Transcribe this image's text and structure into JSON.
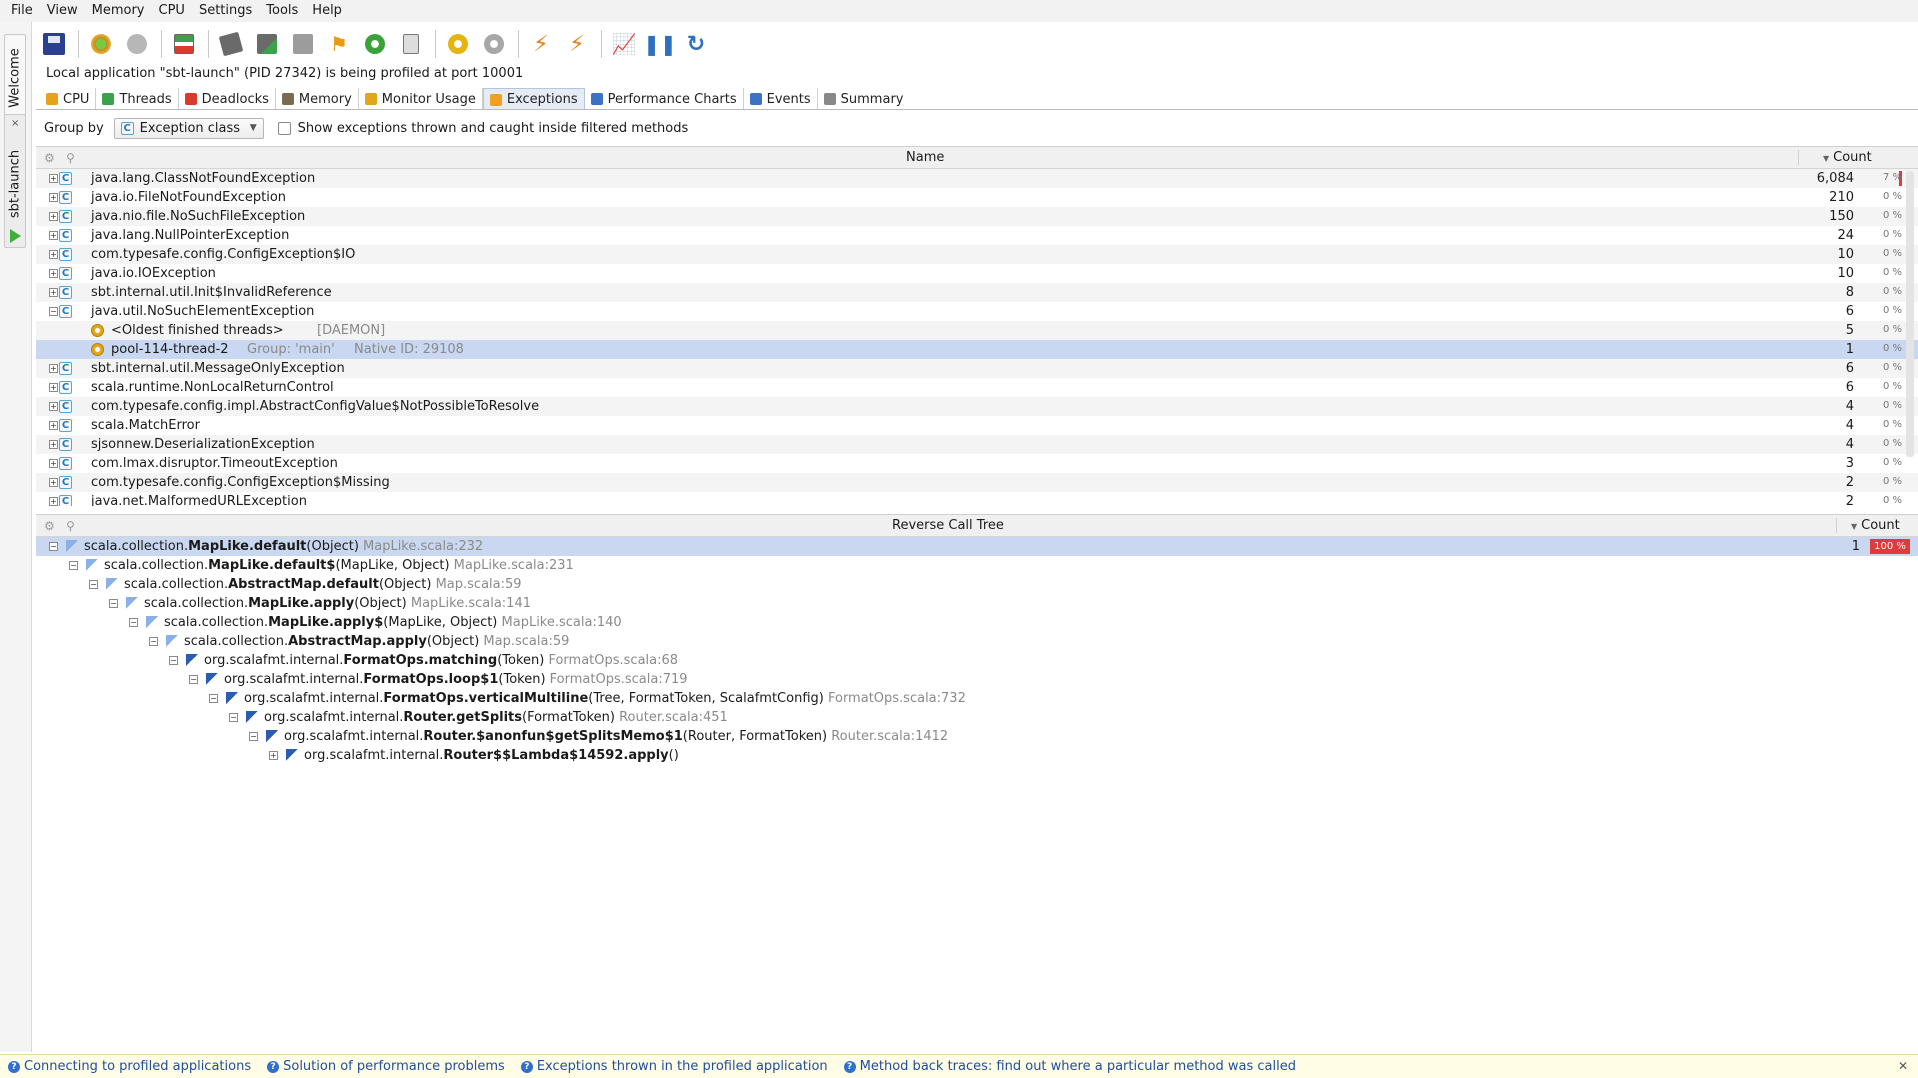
{
  "menu": [
    "File",
    "View",
    "Memory",
    "CPU",
    "Settings",
    "Tools",
    "Help"
  ],
  "side_tabs": {
    "welcome": "Welcome",
    "session": "sbt-launch"
  },
  "status_line": "Local application \"sbt-launch\" (PID 27342) is being profiled at port 10001",
  "view_tabs": [
    {
      "label": "CPU",
      "color": "#e6a21c"
    },
    {
      "label": "Threads",
      "color": "#3aa24a"
    },
    {
      "label": "Deadlocks",
      "color": "#d83b2b"
    },
    {
      "label": "Memory",
      "color": "#7a6a4f"
    },
    {
      "label": "Monitor Usage",
      "color": "#e0a71c"
    },
    {
      "label": "Exceptions",
      "color": "#f0a020"
    },
    {
      "label": "Performance Charts",
      "color": "#3a72c4"
    },
    {
      "label": "Events",
      "color": "#3a72c4"
    },
    {
      "label": "Summary",
      "color": "#888888"
    }
  ],
  "active_view_tab": "Exceptions",
  "group_by": {
    "label": "Group by",
    "value": "Exception class",
    "checkbox_label": "Show exceptions thrown and caught inside filtered methods"
  },
  "exceptions": {
    "header_name": "Name",
    "header_count": "Count",
    "rows": [
      {
        "name": "java.lang.ClassNotFoundException",
        "count": "6,084",
        "pct": "7 %"
      },
      {
        "name": "java.io.FileNotFoundException",
        "count": "210",
        "pct": "0 %"
      },
      {
        "name": "java.nio.file.NoSuchFileException",
        "count": "150",
        "pct": "0 %"
      },
      {
        "name": "java.lang.NullPointerException",
        "count": "24",
        "pct": "0 %"
      },
      {
        "name": "com.typesafe.config.ConfigException$IO",
        "count": "10",
        "pct": "0 %"
      },
      {
        "name": "java.io.IOException",
        "count": "10",
        "pct": "0 %"
      },
      {
        "name": "sbt.internal.util.Init$InvalidReference",
        "count": "8",
        "pct": "0 %"
      },
      {
        "name": "java.util.NoSuchElementException",
        "count": "6",
        "pct": "0 %"
      },
      {
        "name": "sbt.internal.util.MessageOnlyException",
        "count": "6",
        "pct": "0 %"
      },
      {
        "name": "scala.runtime.NonLocalReturnControl",
        "count": "6",
        "pct": "0 %"
      },
      {
        "name": "com.typesafe.config.impl.AbstractConfigValue$NotPossibleToResolve",
        "count": "4",
        "pct": "0 %"
      },
      {
        "name": "scala.MatchError",
        "count": "4",
        "pct": "0 %"
      },
      {
        "name": "sjsonnew.DeserializationException",
        "count": "4",
        "pct": "0 %"
      },
      {
        "name": "com.lmax.disruptor.TimeoutException",
        "count": "3",
        "pct": "0 %"
      },
      {
        "name": "com.typesafe.config.ConfigException$Missing",
        "count": "2",
        "pct": "0 %"
      }
    ],
    "thread_rows": [
      {
        "name": "<Oldest finished threads>",
        "extra": "[DAEMON]",
        "native": "",
        "count": "5",
        "pct": "0 %"
      },
      {
        "name": "pool-114-thread-2",
        "extra": "Group: 'main'",
        "native": "Native ID: 29108",
        "count": "1",
        "pct": "0 %"
      }
    ],
    "cut_row": {
      "name": "java.net.MalformedURLException",
      "count": "2",
      "pct": "0 %"
    },
    "first_pct_fraction": 0.07
  },
  "call_tree": {
    "header_name": "Reverse Call Tree",
    "header_count": "Count",
    "rows": [
      {
        "pre": "scala.collection.",
        "cls": "MapLike.default",
        "args": "(Object)",
        "loc": "MapLike.scala:232",
        "count": "1",
        "pct": "100 %",
        "kind": "light"
      },
      {
        "pre": "scala.collection.",
        "cls": "MapLike.default$",
        "args": "(MapLike, Object)",
        "loc": "MapLike.scala:231",
        "count": "",
        "pct": "",
        "kind": "light"
      },
      {
        "pre": "scala.collection.",
        "cls": "AbstractMap.default",
        "args": "(Object)",
        "loc": "Map.scala:59",
        "count": "",
        "pct": "",
        "kind": "light"
      },
      {
        "pre": "scala.collection.",
        "cls": "MapLike.apply",
        "args": "(Object)",
        "loc": "MapLike.scala:141",
        "count": "",
        "pct": "",
        "kind": "light"
      },
      {
        "pre": "scala.collection.",
        "cls": "MapLike.apply$",
        "args": "(MapLike, Object)",
        "loc": "MapLike.scala:140",
        "count": "",
        "pct": "",
        "kind": "light"
      },
      {
        "pre": "scala.collection.",
        "cls": "AbstractMap.apply",
        "args": "(Object)",
        "loc": "Map.scala:59",
        "count": "",
        "pct": "",
        "kind": "light"
      },
      {
        "pre": "org.scalafmt.internal.",
        "cls": "FormatOps.matching",
        "args": "(Token)",
        "loc": "FormatOps.scala:68",
        "count": "",
        "pct": "",
        "kind": "dark"
      },
      {
        "pre": "org.scalafmt.internal.",
        "cls": "FormatOps.loop$1",
        "args": "(Token)",
        "loc": "FormatOps.scala:719",
        "count": "",
        "pct": "",
        "kind": "dark"
      },
      {
        "pre": "org.scalafmt.internal.",
        "cls": "FormatOps.verticalMultiline",
        "args": "(Tree, FormatToken, ScalafmtConfig)",
        "loc": "FormatOps.scala:732",
        "count": "",
        "pct": "",
        "kind": "dark"
      },
      {
        "pre": "org.scalafmt.internal.",
        "cls": "Router.getSplits",
        "args": "(FormatToken)",
        "loc": "Router.scala:451",
        "count": "",
        "pct": "",
        "kind": "dark"
      },
      {
        "pre": "org.scalafmt.internal.",
        "cls": "Router.$anonfun$getSplitsMemo$1",
        "args": "(Router, FormatToken)",
        "loc": "Router.scala:1412",
        "count": "",
        "pct": "",
        "kind": "dark"
      },
      {
        "pre": "org.scalafmt.internal.",
        "cls": "Router$$Lambda$14592.apply",
        "args": "()",
        "loc": "",
        "count": "",
        "pct": "",
        "kind": "dark"
      }
    ]
  },
  "help_links": [
    "Connecting to profiled applications",
    "Solution of performance problems",
    "Exceptions thrown in the profiled application",
    "Method back traces: find out where a particular method was called"
  ],
  "colors": {
    "selection": "#c9d7f0",
    "pct_bar": "#e03a3a",
    "link": "#1f4e9c"
  }
}
